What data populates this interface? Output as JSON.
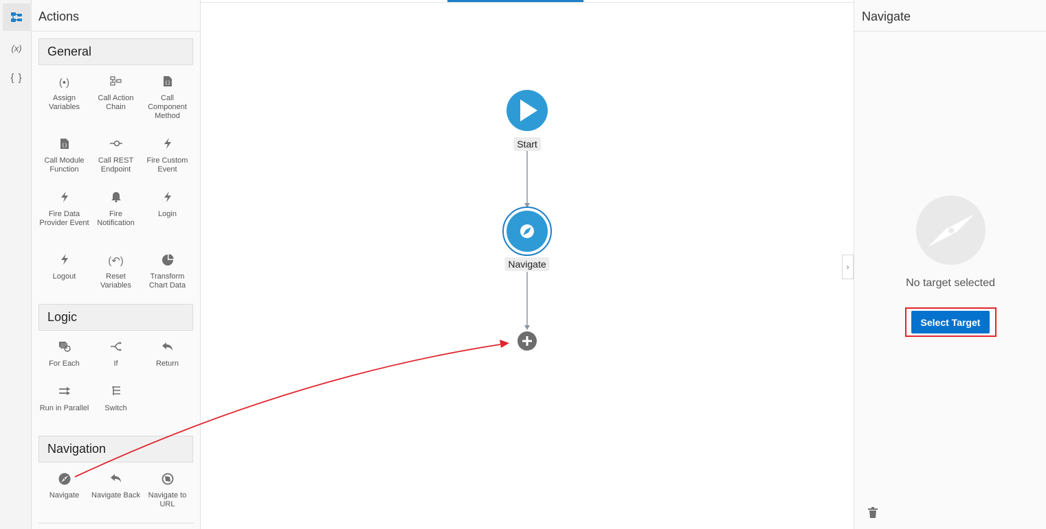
{
  "rail": {
    "items": [
      {
        "name": "action-chain",
        "label": ""
      },
      {
        "name": "variables",
        "label": "(x)"
      },
      {
        "name": "json",
        "label": "{ }"
      }
    ]
  },
  "actions": {
    "title": "Actions",
    "sections": [
      {
        "title": "General",
        "items": [
          {
            "label": "Assign Variables",
            "icon": "assign-variables-icon"
          },
          {
            "label": "Call Action Chain",
            "icon": "action-chain-icon"
          },
          {
            "label": "Call Component Method",
            "icon": "component-method-icon"
          },
          {
            "label": "Call Module Function",
            "icon": "module-function-icon"
          },
          {
            "label": "Call REST Endpoint",
            "icon": "rest-endpoint-icon"
          },
          {
            "label": "Fire Custom Event",
            "icon": "lightning-icon"
          },
          {
            "label": "Fire Data Provider Event",
            "icon": "lightning-icon"
          },
          {
            "label": "Fire Notification",
            "icon": "bell-icon"
          },
          {
            "label": "Login",
            "icon": "lightning-icon"
          },
          {
            "label": "Logout",
            "icon": "lightning-icon"
          },
          {
            "label": "Reset Variables",
            "icon": "reset-variables-icon"
          },
          {
            "label": "Transform Chart Data",
            "icon": "pie-chart-icon"
          }
        ]
      },
      {
        "title": "Logic",
        "items": [
          {
            "label": "For Each",
            "icon": "for-each-icon"
          },
          {
            "label": "If",
            "icon": "if-icon"
          },
          {
            "label": "Return",
            "icon": "return-icon"
          },
          {
            "label": "Run in Parallel",
            "icon": "parallel-icon"
          },
          {
            "label": "Switch",
            "icon": "switch-icon"
          }
        ]
      },
      {
        "title": "Navigation",
        "items": [
          {
            "label": "Navigate",
            "icon": "compass-icon"
          },
          {
            "label": "Navigate Back",
            "icon": "back-arrow-icon"
          },
          {
            "label": "Navigate to URL",
            "icon": "globe-icon"
          }
        ]
      }
    ]
  },
  "canvas": {
    "start_label": "Start",
    "navigate_label": "Navigate"
  },
  "props": {
    "title": "Navigate",
    "empty_text": "No target selected",
    "select_button": "Select Target"
  },
  "colors": {
    "accent": "#0572ce",
    "node": "#2e9bd6",
    "annotation": "#e0252d"
  }
}
